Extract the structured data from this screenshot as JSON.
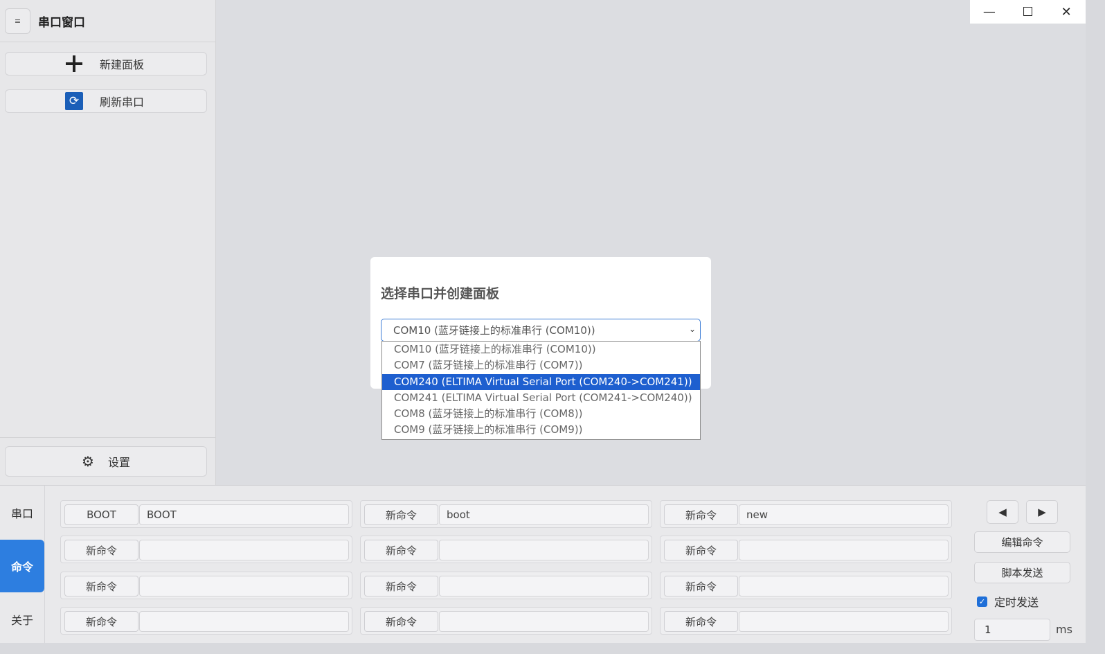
{
  "window": {
    "controls": {
      "minimize": "—",
      "maximize": "☐",
      "close": "✕"
    }
  },
  "sidebar": {
    "menu_icon": "≡",
    "title": "串口窗口",
    "new_panel_label": "新建面板",
    "refresh_label": "刷新串口",
    "refresh_icon": "⟳",
    "settings_icon": "⚙",
    "settings_label": "设置"
  },
  "dialog": {
    "title": "选择串口并创建面板",
    "selected_value": "COM10 (蓝牙链接上的标准串行 (COM10))",
    "chevron_icon": "⌄",
    "options": [
      {
        "label": "COM10 (蓝牙链接上的标准串行 (COM10))"
      },
      {
        "label": "COM7 (蓝牙链接上的标准串行 (COM7))"
      },
      {
        "label": "COM240 (ELTIMA Virtual Serial Port (COM240->COM241))"
      },
      {
        "label": "COM241 (ELTIMA Virtual Serial Port (COM241->COM240))"
      },
      {
        "label": "COM8 (蓝牙链接上的标准串行 (COM8))"
      },
      {
        "label": "COM9 (蓝牙链接上的标准串行 (COM9))"
      }
    ],
    "highlighted_index": 2
  },
  "bottom": {
    "tabs": [
      "串口",
      "命令",
      "关于"
    ],
    "active_tab": 1,
    "commands": [
      [
        {
          "name": "BOOT",
          "value": "BOOT"
        },
        {
          "name": "新命令",
          "value": "boot"
        },
        {
          "name": "新命令",
          "value": "new"
        }
      ],
      [
        {
          "name": "新命令",
          "value": ""
        },
        {
          "name": "新命令",
          "value": ""
        },
        {
          "name": "新命令",
          "value": ""
        }
      ],
      [
        {
          "name": "新命令",
          "value": ""
        },
        {
          "name": "新命令",
          "value": ""
        },
        {
          "name": "新命令",
          "value": ""
        }
      ],
      [
        {
          "name": "新命令",
          "value": ""
        },
        {
          "name": "新命令",
          "value": ""
        },
        {
          "name": "新命令",
          "value": ""
        }
      ]
    ],
    "prev_icon": "◀",
    "next_icon": "▶",
    "edit_label": "编辑命令",
    "script_label": "脚本发送",
    "timer_label": "定时发送",
    "timer_checked": true,
    "interval_value": "1",
    "interval_unit": "ms"
  },
  "colors": {
    "accent": "#2d7ee0",
    "selection": "#1e5fcf",
    "background": "#dcdde1"
  }
}
